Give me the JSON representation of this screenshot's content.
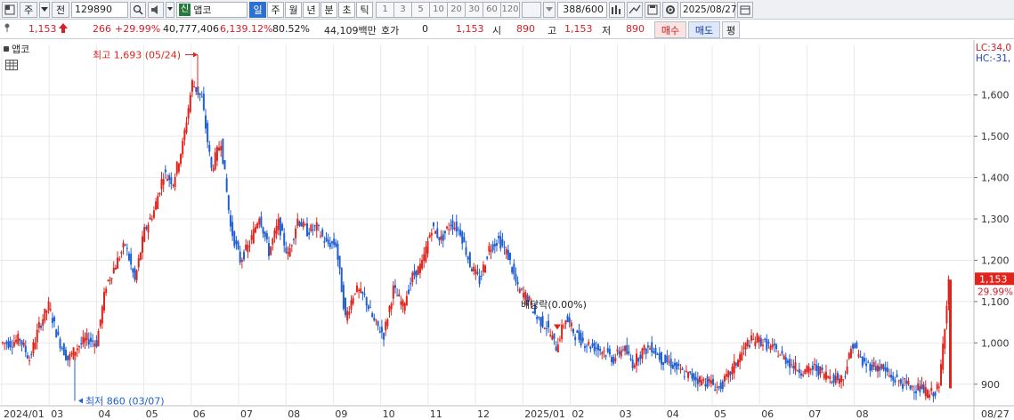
{
  "toolbar": {
    "market_label": "주",
    "prev_label": "전",
    "code": "129890",
    "name_tag": "신",
    "name": "앱코",
    "periods": [
      {
        "label": "일",
        "active": true
      },
      {
        "label": "주",
        "active": false
      },
      {
        "label": "월",
        "active": false
      },
      {
        "label": "년",
        "active": false
      },
      {
        "label": "분",
        "active": false
      },
      {
        "label": "초",
        "active": false
      },
      {
        "label": "틱",
        "active": false
      }
    ],
    "intervals": [
      "1",
      "3",
      "5",
      "10",
      "20",
      "30",
      "60",
      "120"
    ],
    "count": "388/600",
    "date": "2025/08/27"
  },
  "quote": {
    "price": "1,153",
    "change": "266",
    "change_pct": "+29.99%",
    "volume": "40,777,406",
    "volume_pct": "6,139.12%",
    "turnover_pct": "80.52%",
    "trade_value": "44,109백만",
    "hoga_label": "호가",
    "hoga_value": "0",
    "ask_price": "1,153",
    "open_label": "시",
    "open_value": "890",
    "high_label": "고",
    "high_value": "1,153",
    "low_label": "저",
    "low_value": "890",
    "buy_label": "매수",
    "sell_label": "매도",
    "eval_label": "평"
  },
  "chart_legend": {
    "name": "앱코"
  },
  "annotations": {
    "high": "최고 1,693 (05/24)",
    "low": "최저 860 (03/07)",
    "dividend": "배당락(0.00%)",
    "lc": "LC:34,0",
    "hc": "HC:-31,",
    "last_price": "1,153",
    "last_pct": "29.99%"
  },
  "colors": {
    "up": "#e0231b",
    "down": "#1f5fd1",
    "grid": "#e6e8ec",
    "price_badge": "#e0231b"
  },
  "chart_data": {
    "type": "candlestick",
    "title": "",
    "xlabel": "",
    "ylabel": "",
    "ylim": [
      850,
      1720
    ],
    "y_ticks": [
      900,
      1000,
      1100,
      1200,
      1300,
      1400,
      1500,
      1600
    ],
    "x_ticks": [
      "2024/01",
      "03",
      "04",
      "05",
      "06",
      "07",
      "08",
      "09",
      "10",
      "11",
      "12",
      "2025/01",
      "02",
      "03",
      "04",
      "05",
      "06",
      "07",
      "08",
      "08/27"
    ],
    "close_path": [
      [
        "2024/01",
        1000
      ],
      [
        "2024/01",
        1010
      ],
      [
        "2024/01",
        960
      ],
      [
        "2024/02",
        1040
      ],
      [
        "2024/02",
        1090
      ],
      [
        "2024/02",
        1010
      ],
      [
        "2024/03",
        960
      ],
      [
        "2024/03",
        990
      ],
      [
        "2024/03",
        1010
      ],
      [
        "2024/04",
        1000
      ],
      [
        "2024/04",
        1140
      ],
      [
        "2024/04",
        1190
      ],
      [
        "2024/04",
        1240
      ],
      [
        "2024/05",
        1150
      ],
      [
        "2024/05",
        1270
      ],
      [
        "2024/05",
        1320
      ],
      [
        "2024/05",
        1410
      ],
      [
        "2024/05",
        1390
      ],
      [
        "2024/05",
        1480
      ],
      [
        "2024/05",
        1630
      ],
      [
        "2024/06",
        1590
      ],
      [
        "2024/06",
        1420
      ],
      [
        "2024/06",
        1490
      ],
      [
        "2024/06",
        1280
      ],
      [
        "2024/06",
        1200
      ],
      [
        "2024/06",
        1240
      ],
      [
        "2024/07",
        1310
      ],
      [
        "2024/07",
        1220
      ],
      [
        "2024/07",
        1290
      ],
      [
        "2024/07",
        1210
      ],
      [
        "2024/07",
        1300
      ],
      [
        "2024/07",
        1270
      ],
      [
        "2024/08",
        1280
      ],
      [
        "2024/08",
        1240
      ],
      [
        "2024/08",
        1240
      ],
      [
        "2024/08",
        1060
      ],
      [
        "2024/08",
        1130
      ],
      [
        "2024/09",
        1110
      ],
      [
        "2024/09",
        1050
      ],
      [
        "2024/09",
        1020
      ],
      [
        "2024/09",
        1130
      ],
      [
        "2024/09",
        1090
      ],
      [
        "2024/10",
        1160
      ],
      [
        "2024/10",
        1190
      ],
      [
        "2024/10",
        1280
      ],
      [
        "2024/10",
        1250
      ],
      [
        "2024/10",
        1290
      ],
      [
        "2024/10",
        1270
      ],
      [
        "2024/11",
        1190
      ],
      [
        "2024/11",
        1150
      ],
      [
        "2024/11",
        1230
      ],
      [
        "2024/11",
        1250
      ],
      [
        "2024/11",
        1210
      ],
      [
        "2024/11",
        1130
      ],
      [
        "2024/11",
        1110
      ],
      [
        "2024/12",
        1060
      ],
      [
        "2024/12",
        1040
      ],
      [
        "2024/12",
        990
      ],
      [
        "2024/12",
        1060
      ],
      [
        "2024/12",
        1020
      ],
      [
        "2025/01",
        1000
      ],
      [
        "2025/01",
        990
      ],
      [
        "2025/01",
        980
      ],
      [
        "2025/01",
        960
      ],
      [
        "2025/02",
        990
      ],
      [
        "2025/02",
        950
      ],
      [
        "2025/02",
        980
      ],
      [
        "2025/02",
        990
      ],
      [
        "2025/03",
        960
      ],
      [
        "2025/03",
        950
      ],
      [
        "2025/03",
        930
      ],
      [
        "2025/03",
        920
      ],
      [
        "2025/04",
        910
      ],
      [
        "2025/04",
        905
      ],
      [
        "2025/04",
        890
      ],
      [
        "2025/04",
        920
      ],
      [
        "2025/04",
        960
      ],
      [
        "2025/05",
        1000
      ],
      [
        "2025/05",
        1010
      ],
      [
        "2025/05",
        995
      ],
      [
        "2025/05",
        980
      ],
      [
        "2025/05",
        960
      ],
      [
        "2025/06",
        940
      ],
      [
        "2025/06",
        930
      ],
      [
        "2025/06",
        940
      ],
      [
        "2025/06",
        925
      ],
      [
        "2025/06",
        915
      ],
      [
        "2025/07",
        915
      ],
      [
        "2025/07",
        1000
      ],
      [
        "2025/07",
        950
      ],
      [
        "2025/07",
        945
      ],
      [
        "2025/07",
        940
      ],
      [
        "2025/08",
        915
      ],
      [
        "2025/08",
        905
      ],
      [
        "2025/08",
        895
      ],
      [
        "2025/08",
        890
      ],
      [
        "2025/08",
        875
      ],
      [
        "2025/08",
        890
      ],
      [
        "2025/08",
        1153
      ]
    ]
  }
}
